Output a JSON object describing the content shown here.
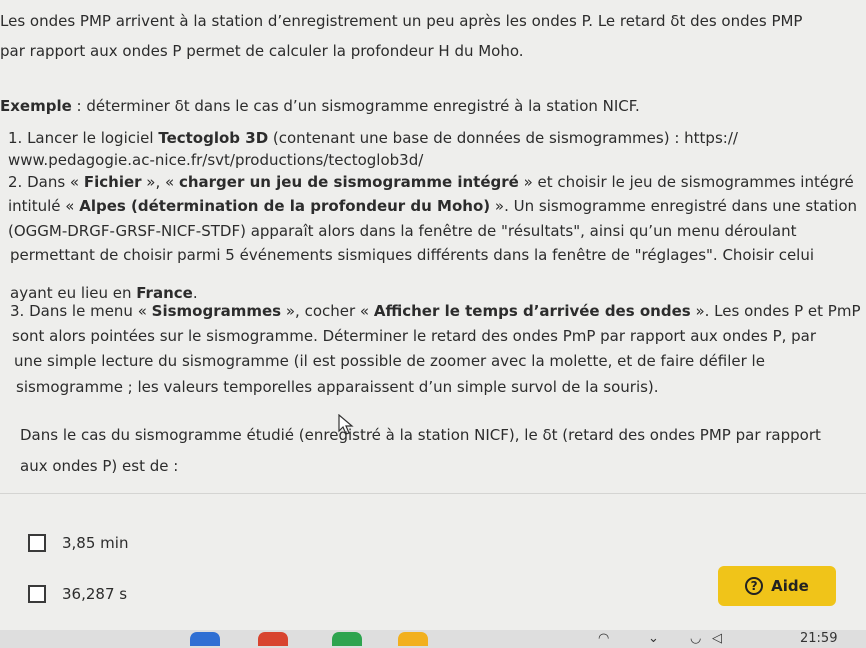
{
  "text": {
    "l1": "Les ondes PMP arrivent à la station d’enregistrement un peu après les ondes P. Le retard δt des ondes PMP",
    "l2": "par rapport aux ondes P permet de calculer la profondeur H du Moho.",
    "l3_bold": "Exemple",
    "l3_rest": " : déterminer δt dans le cas d’un sismogramme enregistré à la station NICF.",
    "l4_pre": "1. Lancer le logiciel ",
    "l4_bold": "Tectoglob 3D",
    "l4_post": " (contenant une base de données de sismogrammes) : https://",
    "l5": "www.pedagogie.ac-nice.fr/svt/productions/tectoglob3d/",
    "l6_pre": "2. Dans « ",
    "l6_b1": "Fichier",
    "l6_mid": " », « ",
    "l6_b2": "charger un jeu de sismogramme intégré",
    "l6_post": " » et choisir le jeu de sismogrammes intégré",
    "l7_pre": "intitulé « ",
    "l7_bold": "Alpes (détermination de la profondeur du Moho)",
    "l7_post": " ». Un sismogramme enregistré dans une station",
    "l8": "(OGGM-DRGF-GRSF-NICF-STDF) apparaît alors dans la fenêtre de \"résultats\", ainsi qu’un menu déroulant",
    "l9": "permettant de choisir parmi 5 événements sismiques différents dans la fenêtre de \"réglages\". Choisir celui",
    "l10_pre": "ayant eu lieu en ",
    "l10_bold": "France",
    "l10_post": ".",
    "l11_pre": "3. Dans le menu « ",
    "l11_b1": "Sismogrammes",
    "l11_mid": " », cocher « ",
    "l11_b2": "Afficher le temps d’arrivée des ondes",
    "l11_post": " ». Les ondes P et PmP",
    "l12": "sont alors pointées sur le sismogramme. Déterminer le retard des ondes PmP par rapport aux ondes P, par",
    "l13": "une simple lecture du sismogramme (il est possible de zoomer avec la molette, et de faire défiler le",
    "l14": "sismogramme ; les valeurs temporelles apparaissent d’un simple survol de la souris).",
    "q1": "Dans le cas du sismogramme étudié (enregistré à la station NICF), le δt (retard des ondes PMP par rapport",
    "q2": "aux ondes P) est de :"
  },
  "options": [
    "3,85 min",
    "36,287 s"
  ],
  "help_button": {
    "label": "Aide"
  },
  "taskbar": {
    "time": "21:59"
  },
  "colors": {
    "accent": "#f0c419",
    "background": "#eeeeec"
  }
}
